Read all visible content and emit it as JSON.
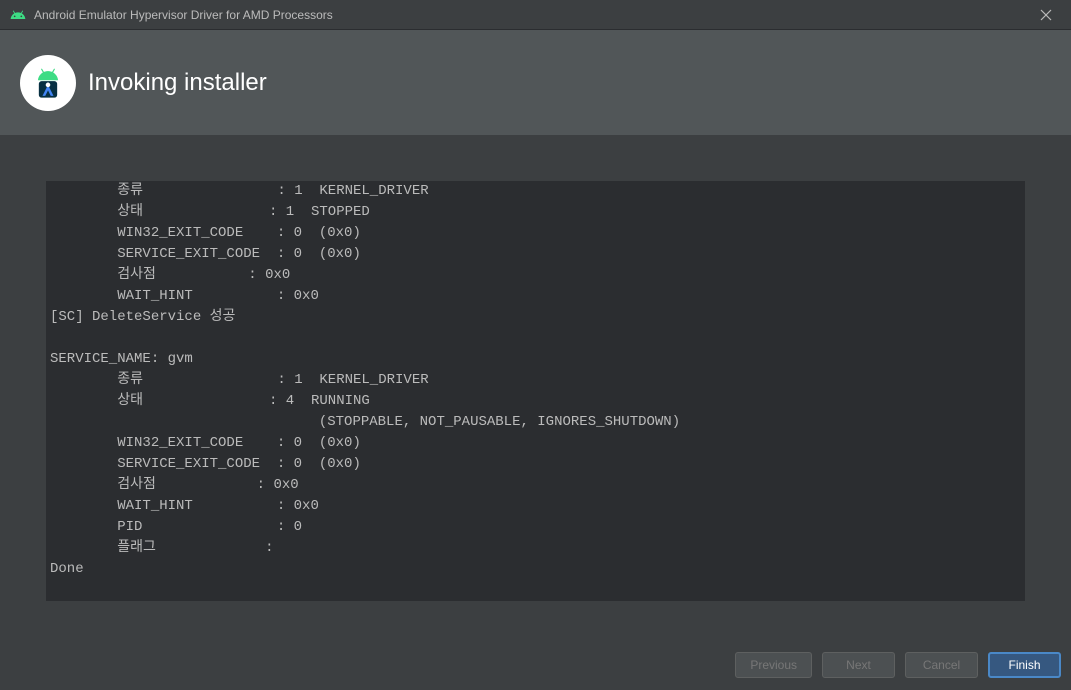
{
  "window": {
    "title": "Android Emulator Hypervisor Driver for AMD Processors"
  },
  "header": {
    "title": "Invoking installer"
  },
  "console": {
    "text": "        종류                : 1  KERNEL_DRIVER\n        상태               : 1  STOPPED\n        WIN32_EXIT_CODE    : 0  (0x0)\n        SERVICE_EXIT_CODE  : 0  (0x0)\n        검사점           : 0x0\n        WAIT_HINT          : 0x0\n[SC] DeleteService 성공\n\nSERVICE_NAME: gvm\n        종류                : 1  KERNEL_DRIVER\n        상태               : 4  RUNNING\n                                (STOPPABLE, NOT_PAUSABLE, IGNORES_SHUTDOWN)\n        WIN32_EXIT_CODE    : 0  (0x0)\n        SERVICE_EXIT_CODE  : 0  (0x0)\n        검사점            : 0x0\n        WAIT_HINT          : 0x0\n        PID                : 0\n        플래그             :\nDone"
  },
  "buttons": {
    "previous": "Previous",
    "next": "Next",
    "cancel": "Cancel",
    "finish": "Finish"
  }
}
